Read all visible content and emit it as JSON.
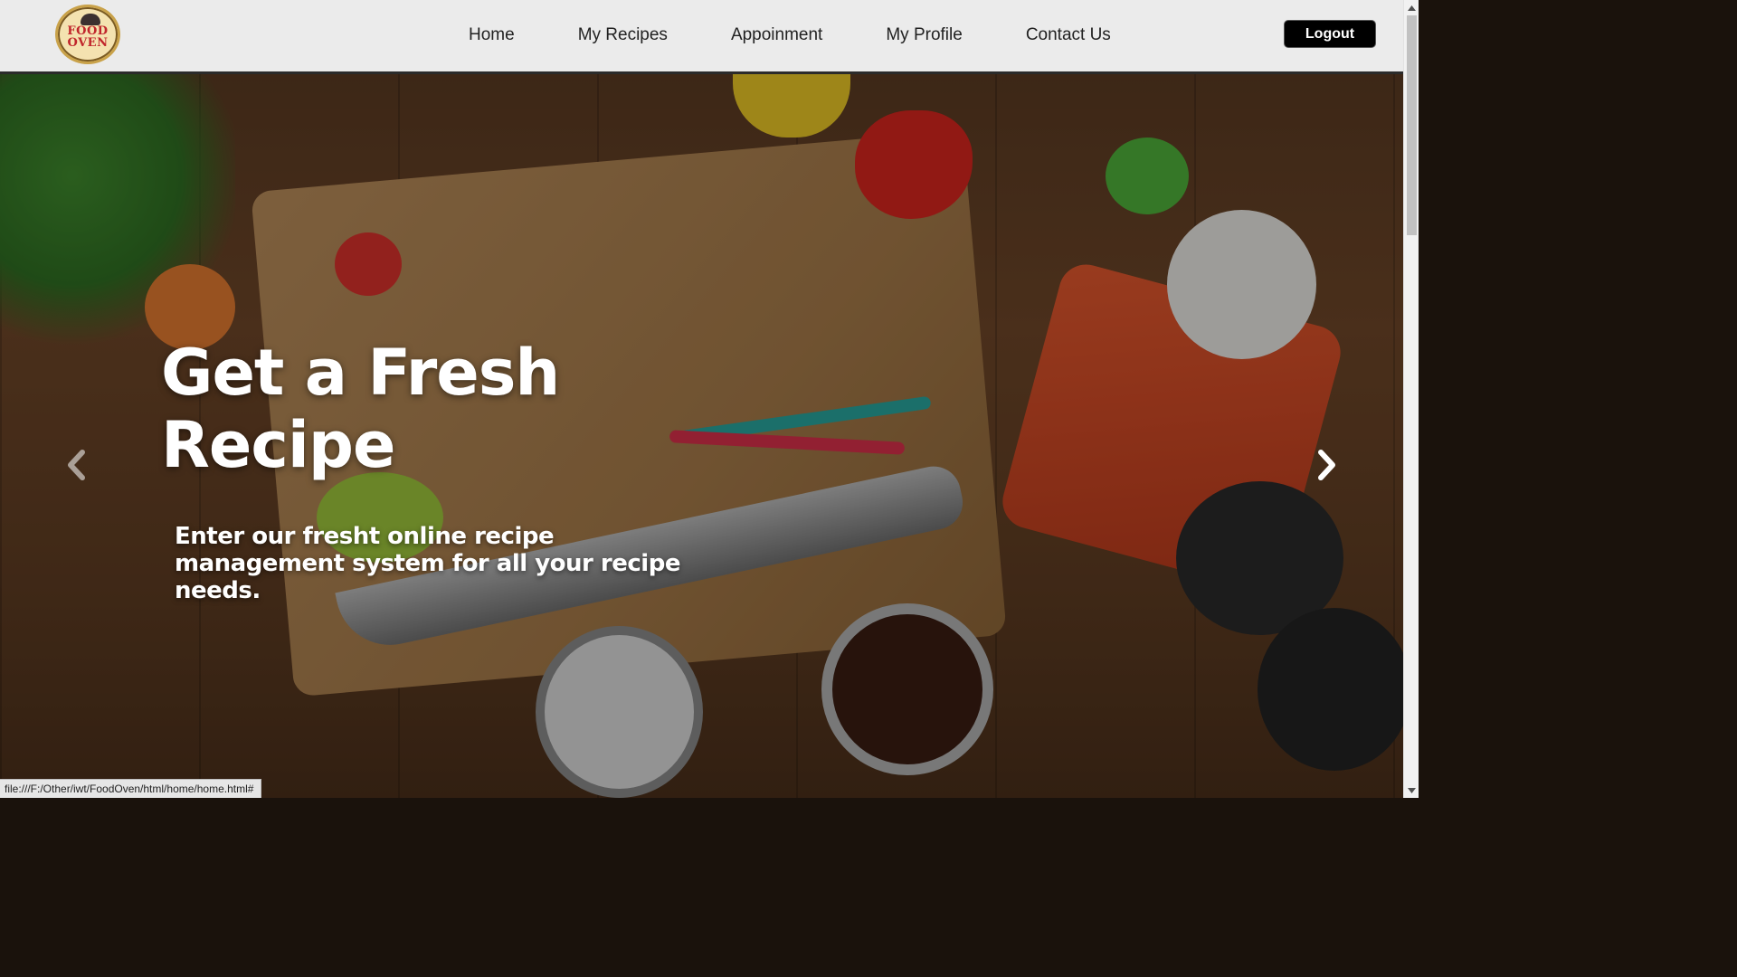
{
  "logo": {
    "text": "FOOD OVEN",
    "icon": "chef-hat-icon"
  },
  "nav": {
    "items": [
      {
        "label": "Home"
      },
      {
        "label": "My Recipes"
      },
      {
        "label": "Appoinment"
      },
      {
        "label": "My Profile"
      },
      {
        "label": "Contact Us"
      }
    ],
    "logout_label": "Logout"
  },
  "hero": {
    "title": "Get a Fresh Recipe",
    "subtitle": "Enter our fresht online recipe management system for all your recipe needs.",
    "prev_icon": "chevron-left-icon",
    "next_icon": "chevron-right-icon"
  },
  "status_bar": {
    "url": "file:///F:/Other/iwt/FoodOven/html/home/home.html#"
  },
  "colors": {
    "navbar_bg": "#ebebeb",
    "logout_bg": "#000000",
    "hero_text": "#ffffff",
    "logo_red": "#c0252b"
  }
}
